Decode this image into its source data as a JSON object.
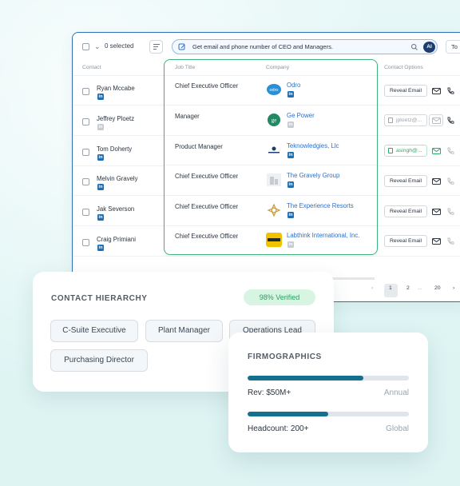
{
  "toolbar": {
    "selected": "0 selected",
    "search_text": "Get email and phone number of CEO and Managers.",
    "ai_badge": "AI",
    "to_label": "To"
  },
  "columns": {
    "contact": "Contact",
    "job_title": "Job Title",
    "company": "Company",
    "contact_options": "Contact Options"
  },
  "rows": [
    {
      "name": "Ryan Mccabe",
      "title": "Chief Executive Officer",
      "company": "Odro",
      "logo_icon": "odro-logo",
      "option": "Reveal Email",
      "option_state": "reveal"
    },
    {
      "name": "Jeffrey Ploetz",
      "title": "Manager",
      "company": "Ge Power",
      "logo_icon": "ge-logo",
      "option": "jploetz@...",
      "option_state": "revealed"
    },
    {
      "name": "Tom Doherty",
      "title": "Product Manager",
      "company": "Teknowledgies, Llc",
      "logo_icon": "teknowledgies-logo",
      "option": "asingh@...",
      "option_state": "verified"
    },
    {
      "name": "Melvin Gravely",
      "title": "Chief Executive Officer",
      "company": "The Gravely Group",
      "logo_icon": "building-logo",
      "option": "Reveal Email",
      "option_state": "reveal"
    },
    {
      "name": "Jak Severson",
      "title": "Chief Executive Officer",
      "company": "The Experience Resorts",
      "logo_icon": "experience-logo",
      "option": "Reveal Email",
      "option_state": "reveal"
    },
    {
      "name": "Craig Primiani",
      "title": "Chief Executive Officer",
      "company": "Labthink International, Inc.",
      "logo_icon": "labthink-logo",
      "option": "Reveal Email",
      "option_state": "reveal"
    }
  ],
  "pagination": {
    "prev": "‹",
    "pages": [
      "1",
      "2",
      "...",
      "20"
    ],
    "next": "›"
  },
  "hierarchy": {
    "title": "CONTACT HIERARCHY",
    "verified": "98% Verified",
    "chips": [
      "C-Suite Executive",
      "Plant Manager",
      "Operations Lead",
      "Purchasing Director"
    ]
  },
  "firmographics": {
    "title": "FIRMOGRAPHICS",
    "rev_label": "Rev: $50M+",
    "rev_scope": "Annual",
    "rev_fill": 0.72,
    "headcount_label": "Headcount: 200+",
    "headcount_scope": "Global",
    "headcount_fill": 0.5
  },
  "colors": {
    "accent": "#15708f",
    "link": "#2f6fc8",
    "verified_green": "#2c9a62",
    "highlight_border": "#3fb37f"
  }
}
